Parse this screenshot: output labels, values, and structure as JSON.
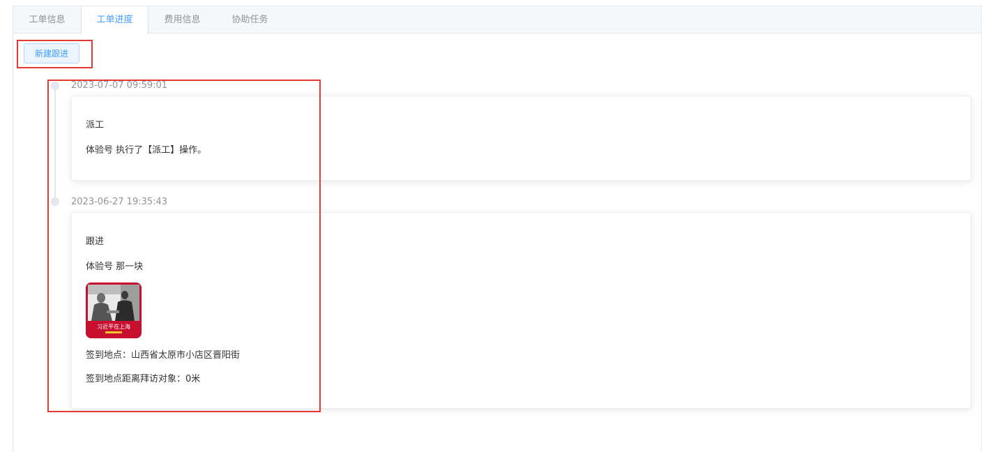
{
  "tabs": [
    {
      "label": "工单信息",
      "active": false
    },
    {
      "label": "工单进度",
      "active": true
    },
    {
      "label": "费用信息",
      "active": false
    },
    {
      "label": "协助任务",
      "active": false
    }
  ],
  "toolbar": {
    "new_followup_label": "新建跟进"
  },
  "timeline": [
    {
      "timestamp": "2023-07-07 09:59:01",
      "title": "派工",
      "description": "体验号 执行了【派工】操作。"
    },
    {
      "timestamp": "2023-06-27 19:35:43",
      "title": "跟进",
      "description": "体验号 那一块",
      "image": {
        "caption": "习近平在上海"
      },
      "checkin_location": "签到地点：山西省太原市小店区晋阳街",
      "checkin_distance": "签到地点距离拜访对象：0米"
    }
  ],
  "colors": {
    "accent": "#409eff",
    "highlight_box": "#e53935",
    "muted_text": "#909399"
  }
}
